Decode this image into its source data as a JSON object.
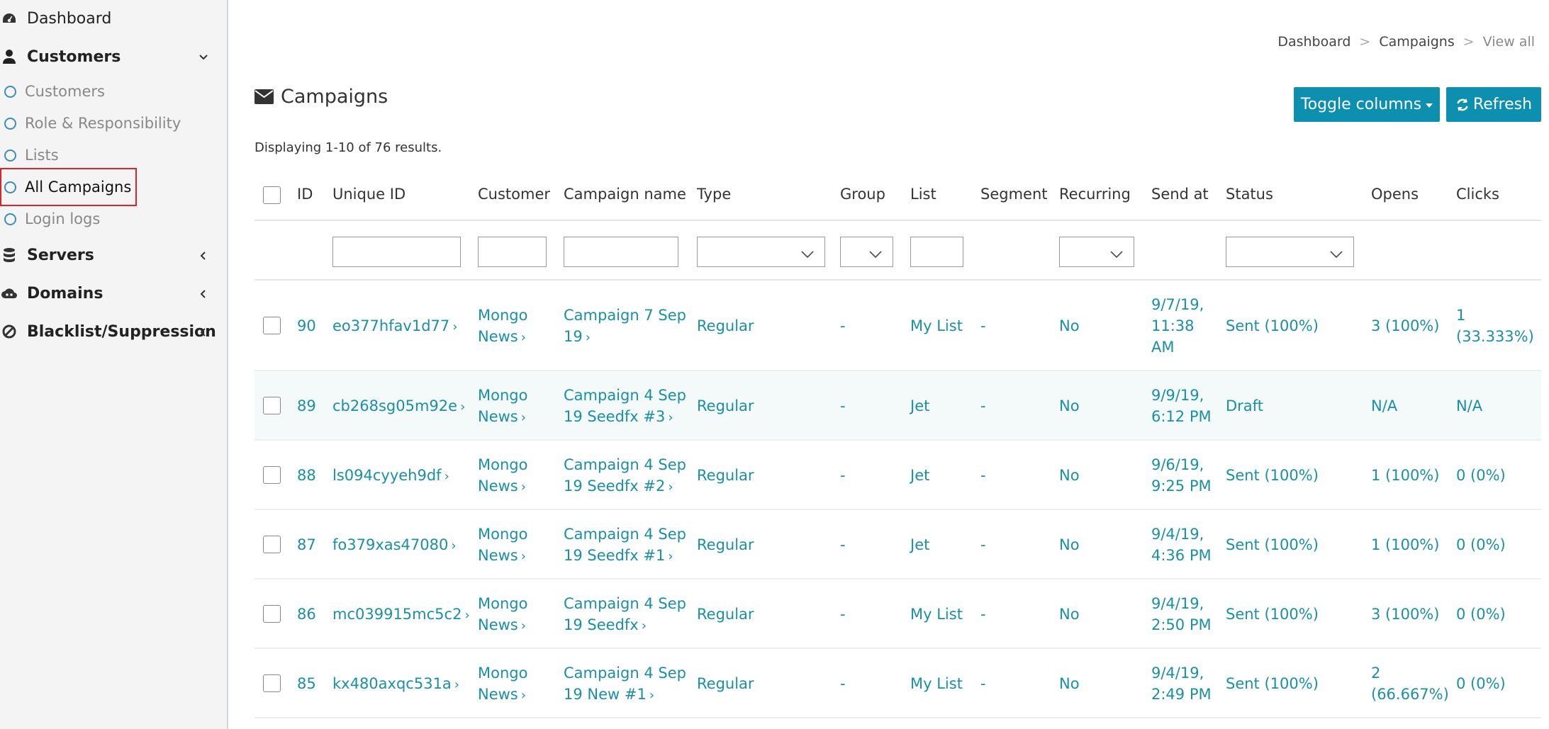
{
  "sidebar": {
    "items": [
      {
        "label": "Dashboard",
        "icon": "dashboard-icon"
      },
      {
        "label": "Customers",
        "icon": "user-icon",
        "expanded": true,
        "children": [
          {
            "label": "Customers"
          },
          {
            "label": "Role & Responsibility"
          },
          {
            "label": "Lists"
          },
          {
            "label": "All Campaigns",
            "active": true
          },
          {
            "label": "Login logs"
          }
        ]
      },
      {
        "label": "Servers",
        "icon": "database-icon"
      },
      {
        "label": "Domains",
        "icon": "cloud-icon"
      },
      {
        "label": "Blacklist/Suppression",
        "icon": "ban-icon"
      }
    ]
  },
  "breadcrumb": {
    "items": [
      "Dashboard",
      "Campaigns",
      "View all"
    ],
    "separator": ">"
  },
  "page": {
    "title": "Campaigns",
    "summary": "Displaying 1-10 of 76 results.",
    "toggle_label": "Toggle columns",
    "refresh_label": "Refresh"
  },
  "table": {
    "columns": [
      "ID",
      "Unique ID",
      "Customer",
      "Campaign name",
      "Type",
      "Group",
      "List",
      "Segment",
      "Recurring",
      "Send at",
      "Status",
      "Opens",
      "Clicks"
    ],
    "rows": [
      {
        "id": "90",
        "uid": "eo377hfav1d77",
        "customer": [
          "Mongo",
          "News"
        ],
        "name": [
          "Campaign 7 Sep",
          "19"
        ],
        "type": "Regular",
        "group": "-",
        "list": "My List",
        "segment": "-",
        "recurring": "No",
        "send_at": [
          "9/7/19,",
          "11:38",
          "AM"
        ],
        "status": "Sent (100%)",
        "opens": [
          "3 (100%)"
        ],
        "clicks": [
          "1",
          "(33.333%)"
        ]
      },
      {
        "id": "89",
        "uid": "cb268sg05m92e",
        "customer": [
          "Mongo",
          "News"
        ],
        "name": [
          "Campaign 4 Sep",
          "19 Seedfx #3"
        ],
        "type": "Regular",
        "group": "-",
        "list": "Jet",
        "segment": "-",
        "recurring": "No",
        "send_at": [
          "9/9/19,",
          "6:12 PM"
        ],
        "status": "Draft",
        "opens": [
          "N/A"
        ],
        "clicks": [
          "N/A"
        ]
      },
      {
        "id": "88",
        "uid": "ls094cyyeh9df",
        "customer": [
          "Mongo",
          "News"
        ],
        "name": [
          "Campaign 4 Sep",
          "19 Seedfx #2"
        ],
        "type": "Regular",
        "group": "-",
        "list": "Jet",
        "segment": "-",
        "recurring": "No",
        "send_at": [
          "9/6/19,",
          "9:25 PM"
        ],
        "status": "Sent (100%)",
        "opens": [
          "1 (100%)"
        ],
        "clicks": [
          "0 (0%)"
        ]
      },
      {
        "id": "87",
        "uid": "fo379xas47080",
        "customer": [
          "Mongo",
          "News"
        ],
        "name": [
          "Campaign 4 Sep",
          "19 Seedfx #1"
        ],
        "type": "Regular",
        "group": "-",
        "list": "Jet",
        "segment": "-",
        "recurring": "No",
        "send_at": [
          "9/4/19,",
          "4:36 PM"
        ],
        "status": "Sent (100%)",
        "opens": [
          "1 (100%)"
        ],
        "clicks": [
          "0 (0%)"
        ]
      },
      {
        "id": "86",
        "uid": "mc039915mc5c2",
        "customer": [
          "Mongo",
          "News"
        ],
        "name": [
          "Campaign 4 Sep",
          "19 Seedfx"
        ],
        "type": "Regular",
        "group": "-",
        "list": "My List",
        "segment": "-",
        "recurring": "No",
        "send_at": [
          "9/4/19,",
          "2:50 PM"
        ],
        "status": "Sent (100%)",
        "opens": [
          "3 (100%)"
        ],
        "clicks": [
          "0 (0%)"
        ]
      },
      {
        "id": "85",
        "uid": "kx480axqc531a",
        "customer": [
          "Mongo",
          "News"
        ],
        "name": [
          "Campaign 4 Sep",
          "19 New #1"
        ],
        "type": "Regular",
        "group": "-",
        "list": "My List",
        "segment": "-",
        "recurring": "No",
        "send_at": [
          "9/4/19,",
          "2:49 PM"
        ],
        "status": "Sent (100%)",
        "opens": [
          "2",
          "(66.667%)"
        ],
        "clicks": [
          "0 (0%)"
        ]
      }
    ]
  },
  "colors": {
    "accent": "#0d8fb0",
    "link": "#1a8fa6",
    "active_border": "#d9262b",
    "sidebar_bg": "#f4f4f4"
  }
}
